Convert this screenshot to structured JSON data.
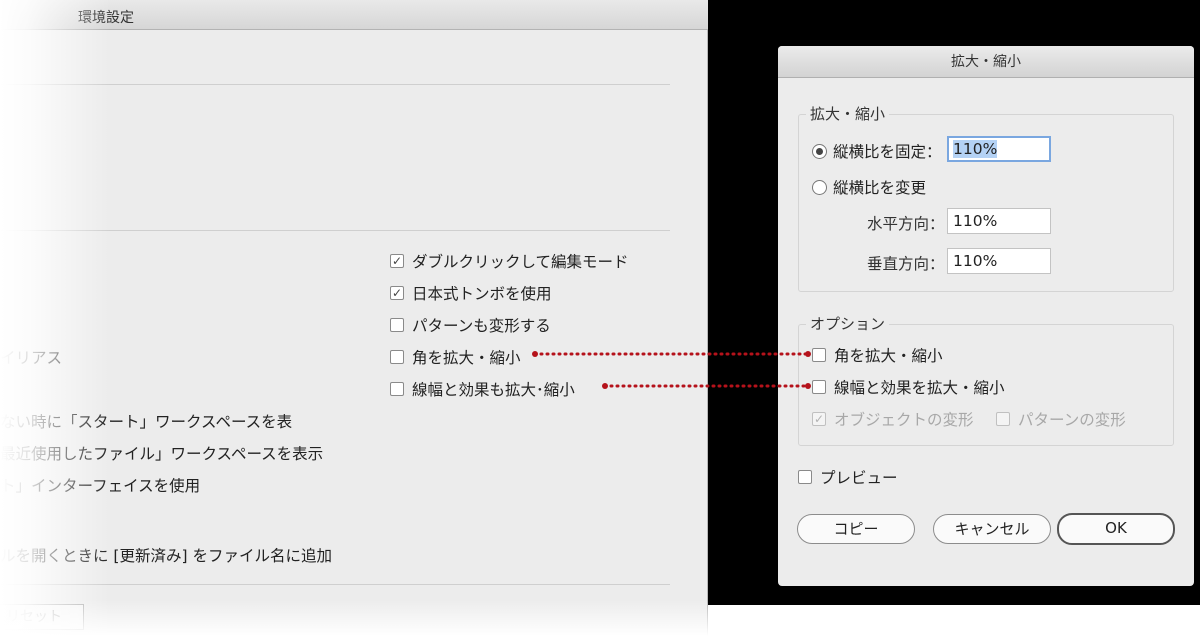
{
  "preferences": {
    "title": "環境設定",
    "checkboxes": [
      {
        "label": "ダブルクリックして編集モード",
        "checked": true
      },
      {
        "label": "日本式トンボを使用",
        "checked": true
      },
      {
        "label": "パターンも変形する",
        "checked": false
      },
      {
        "label": "角を拡大・縮小",
        "checked": false
      },
      {
        "label": "線幅と効果も拡大･縮小",
        "checked": false
      }
    ],
    "partial_lines": [
      "イリアス",
      "ない時に「スタート」ワークスペースを表",
      "最近使用したファイル」ワークスペースを表示",
      "ト」インターフェイスを使用",
      "ルを開くときに [更新済み] をファイル名に追加"
    ],
    "reset_label": "リセット"
  },
  "scale_dialog": {
    "title": "拡大・縮小",
    "scale_group_label": "拡大・縮小",
    "uniform": {
      "label": "縦横比を固定：",
      "value": "110%",
      "selected": true
    },
    "non_uniform": {
      "label": "縦横比を変更",
      "selected": false
    },
    "horizontal": {
      "label": "水平方向：",
      "value": "110%"
    },
    "vertical": {
      "label": "垂直方向：",
      "value": "110%"
    },
    "options_group_label": "オプション",
    "scale_corners": {
      "label": "角を拡大・縮小",
      "checked": false
    },
    "scale_strokes": {
      "label": "線幅と効果を拡大・縮小",
      "checked": false
    },
    "transform_objects": {
      "label": "オブジェクトの変形",
      "checked": true,
      "disabled": true
    },
    "transform_patterns": {
      "label": "パターンの変形",
      "checked": false,
      "disabled": true
    },
    "preview": {
      "label": "プレビュー",
      "checked": false
    },
    "buttons": {
      "copy": "コピー",
      "cancel": "キャンセル",
      "ok": "OK"
    }
  },
  "colors": {
    "connector": "#b5121b",
    "focus_ring": "#7aa7e0",
    "selection": "#b4d2f5"
  }
}
